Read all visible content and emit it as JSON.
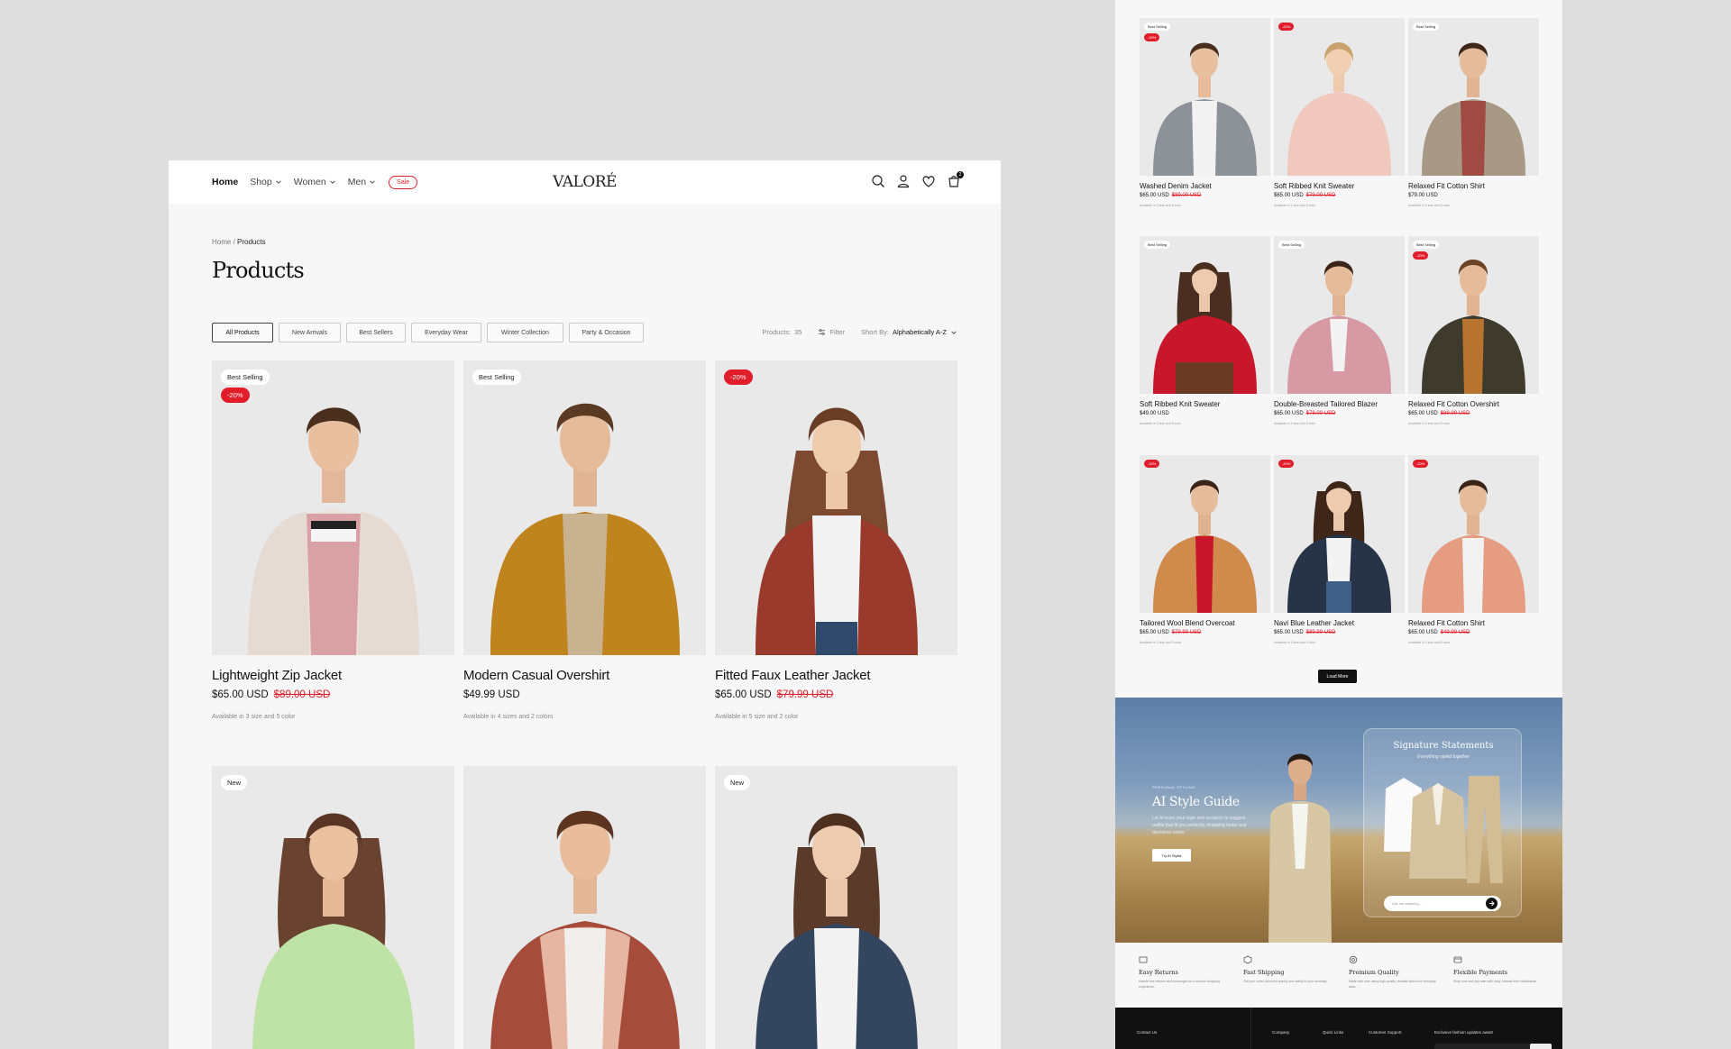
{
  "store": {
    "nav": {
      "home": "Home",
      "shop": "Shop",
      "women": "Women",
      "men": "Men",
      "sale": "Sale",
      "cart_count": "2"
    },
    "logo": "VALORÉ",
    "breadcrumb": {
      "home": "Home",
      "sep": " / ",
      "current": "Products"
    },
    "title": "Products",
    "filters": [
      "All Products",
      "New Arrivals",
      "Best Sellers",
      "Everyday Wear",
      "Winter Collection",
      "Party & Occasion"
    ],
    "toolbar": {
      "products_label": "Products:",
      "products_count": "35",
      "filter": "Filter",
      "sort_label": "Short By:",
      "sort_value": "Alphabetically A-Z"
    },
    "products": [
      {
        "name": "Lightweight Zip Jacket",
        "price": "$65.00 USD",
        "old_price": "$89.00 USD",
        "availability": "Available in 3 size and 5 color",
        "badge": "Best Selling",
        "sale_badge": "-20%"
      },
      {
        "name": "Modern Casual Overshirt",
        "price": "$49.99 USD",
        "old_price": "",
        "availability": "Available in 4 sizes and 2 colors",
        "badge": "Best Selling",
        "sale_badge": ""
      },
      {
        "name": "Fitted Faux Leather Jacket",
        "price": "$65.00 USD",
        "old_price": "$79.99 USD",
        "availability": "Available in 5 size and 2 color",
        "badge": "",
        "sale_badge": "-20%"
      },
      {
        "name": "",
        "price": "",
        "old_price": "",
        "availability": "",
        "badge": "New",
        "sale_badge": ""
      },
      {
        "name": "",
        "price": "",
        "old_price": "",
        "availability": "",
        "badge": "",
        "sale_badge": ""
      },
      {
        "name": "",
        "price": "",
        "old_price": "",
        "availability": "",
        "badge": "New",
        "sale_badge": ""
      }
    ]
  },
  "right": {
    "products": [
      {
        "name": "Washed Denim Jacket",
        "price": "$65.00 USD",
        "old_price": "$89.00 USD",
        "availability": "Available in 3 size and 5 color",
        "badge": "Best Selling",
        "sale_badge": "-20%"
      },
      {
        "name": "Soft Ribbed Knit Sweater",
        "price": "$65.00 USD",
        "old_price": "$79.00 USD",
        "availability": "Available in 3 size and 5 color",
        "badge": "",
        "sale_badge": "-20%"
      },
      {
        "name": "Relaxed Fit Cotton Shirt",
        "price": "$79.00 USD",
        "old_price": "",
        "availability": "Available in 3 size and 5 color",
        "badge": "Best Selling",
        "sale_badge": ""
      },
      {
        "name": "Soft Ribbed Knit Sweater",
        "price": "$49.00 USD",
        "old_price": "",
        "availability": "Available in 3 size and 5 color",
        "badge": "Best Selling",
        "sale_badge": ""
      },
      {
        "name": "Double-Breasted Tailored Blazer",
        "price": "$65.00 USD",
        "old_price": "$78.00 USD",
        "availability": "Available in 3 size and 5 color",
        "badge": "Best Selling",
        "sale_badge": ""
      },
      {
        "name": "Relaxed Fit Cotton Overshirt",
        "price": "$65.00 USD",
        "old_price": "$89.99 USD",
        "availability": "Available in 3 size and 5 color",
        "badge": "Best Selling",
        "sale_badge": "-20%"
      },
      {
        "name": "Tailored Wool Blend Overcoat",
        "price": "$65.00 USD",
        "old_price": "$79.99 USD",
        "availability": "Available in 3 size and 5 color",
        "badge": "",
        "sale_badge": "-20%"
      },
      {
        "name": "Navi Blue Leather Jacket",
        "price": "$65.00 USD",
        "old_price": "$89.99 USD",
        "availability": "Available in 3 size and 5 color",
        "badge": "",
        "sale_badge": "-20%"
      },
      {
        "name": "Relaxed Fit Cotton Shirt",
        "price": "$65.00 USD",
        "old_price": "$49.99 USD",
        "availability": "Available in 3 size and 5 color",
        "badge": "",
        "sale_badge": "-20%"
      }
    ],
    "load_more": "Load More",
    "hero": {
      "eyebrow": "PERSONAL STYLING",
      "title": "AI Style Guide",
      "description": "Let AI learn your style and occasion to suggest outfits that fit you perfectly, shopping faster and decisions easier.",
      "button": "Try AI Stylist",
      "card_title": "Signature Statements",
      "card_subtitle": "Everything styled together",
      "ask_placeholder": "Ask me anything..."
    },
    "features": [
      {
        "title": "Easy Returns",
        "desc": "Hassle-free returns and exchanges for a smooth shopping experience."
      },
      {
        "title": "Fast Shipping",
        "desc": "Get your order delivered quickly and safely to your doorstep."
      },
      {
        "title": "Premium Quality",
        "desc": "Made with care using high-quality, durable fabrics for everyday wear."
      },
      {
        "title": "Flexible Payments",
        "desc": "Shop now and pay later with easy, interest-free installments."
      }
    ],
    "footer": {
      "contact": "Contact Us",
      "company": "Company",
      "quick_links": "Quick Links",
      "support": "Customer Support",
      "newsletter": "Exclusive fashion updates await!"
    }
  },
  "colors": {
    "accent": "#e11d2a",
    "dark": "#111111",
    "page_bg": "#dedede",
    "card_bg": "#e9e9e9"
  }
}
